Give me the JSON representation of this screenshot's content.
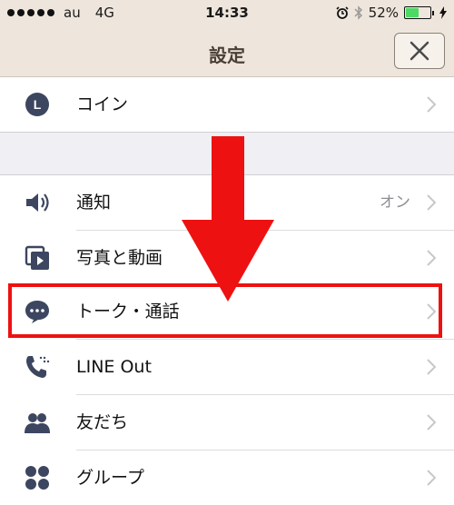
{
  "status_bar": {
    "carrier": "au",
    "network": "4G",
    "time": "14:33",
    "battery_percent": "52%",
    "battery_level": 0.52
  },
  "header": {
    "title": "設定"
  },
  "settings": {
    "coin": {
      "label": "コイン",
      "icon": "coin-L-icon"
    },
    "notifications": {
      "label": "通知",
      "value": "オン",
      "icon": "speaker-icon"
    },
    "photos_videos": {
      "label": "写真と動画",
      "icon": "media-icon"
    },
    "chats_calls": {
      "label": "トーク・通話",
      "icon": "chat-bubble-icon"
    },
    "line_out": {
      "label": "LINE Out",
      "icon": "phone-icon"
    },
    "friends": {
      "label": "友だち",
      "icon": "friends-icon"
    },
    "groups": {
      "label": "グループ",
      "icon": "groups-icon"
    }
  },
  "colors": {
    "header_bg": "#eee6dc",
    "icon": "#3d4660",
    "highlight": "#ee1111"
  }
}
